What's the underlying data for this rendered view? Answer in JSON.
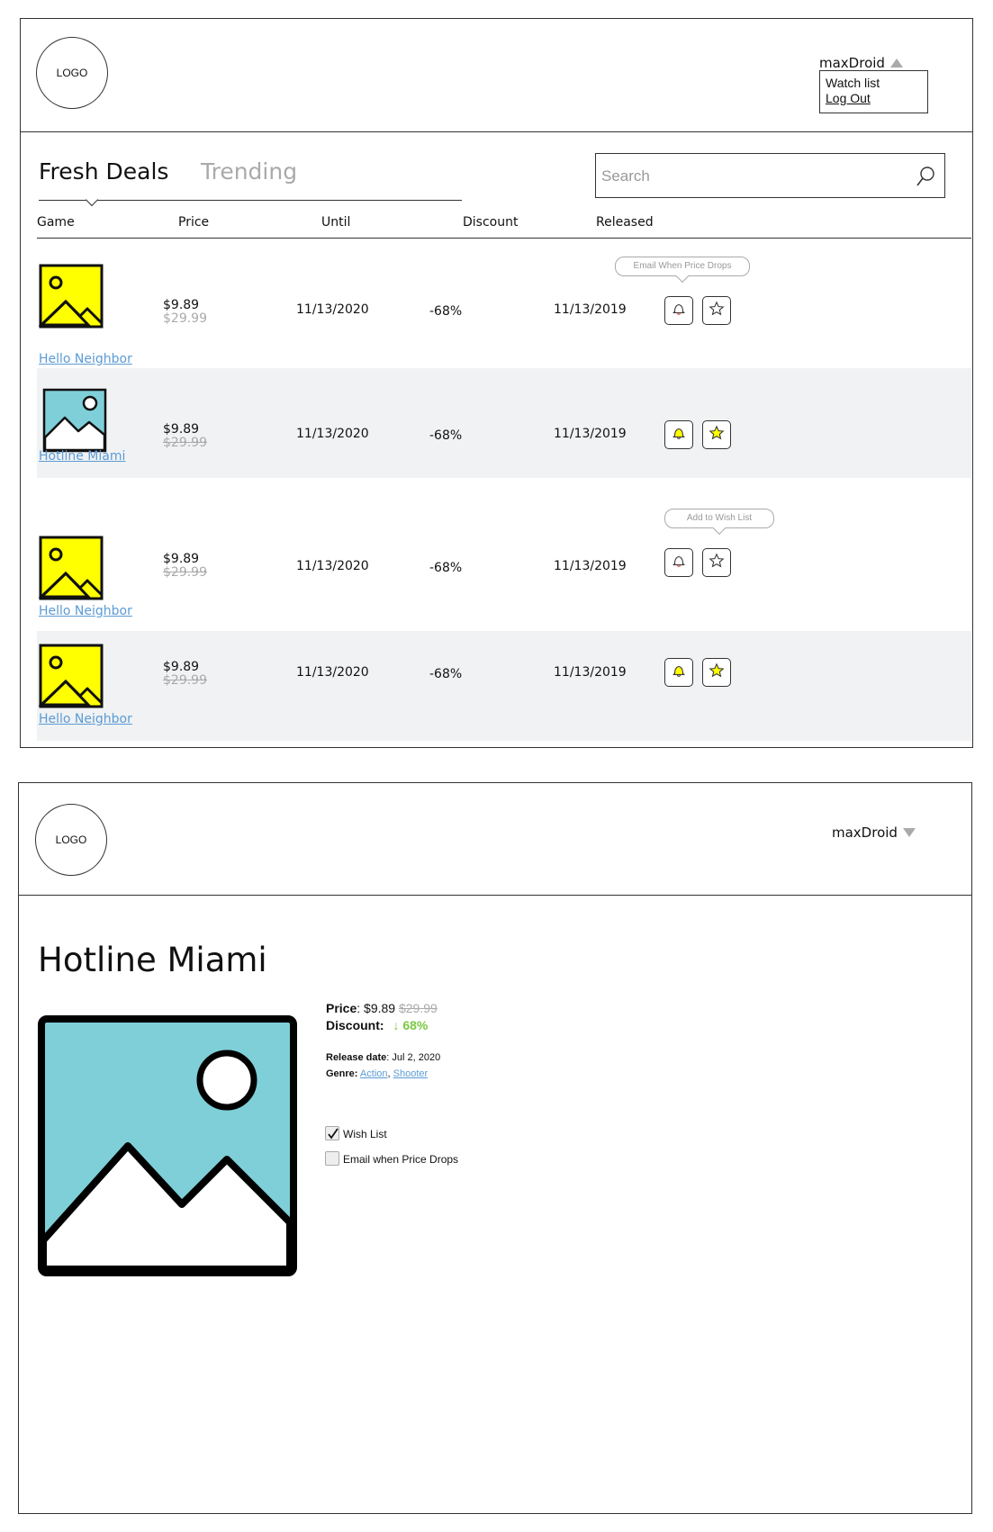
{
  "screen1": {
    "logo": "LOGO",
    "user": {
      "name": "maxDroid",
      "menu": [
        "Watch list",
        "Log Out"
      ]
    },
    "tabs": {
      "active": "Fresh Deals",
      "inactive": "Trending"
    },
    "search": {
      "placeholder": "Search"
    },
    "columns": [
      "Game",
      "Price",
      "Until",
      "Discount",
      "Released"
    ],
    "rows": [
      {
        "name": "Hello Neighbor",
        "thumb": "yellow",
        "price": "$9.89",
        "old_price": "$29.99",
        "until": "11/13/2020",
        "discount": "-68%",
        "released": "11/13/2019",
        "bell_on": false,
        "star_on": false,
        "tooltip": "Email When Price Drops"
      },
      {
        "name": "Hotline Miami",
        "thumb": "blue",
        "price": "$9.89",
        "old_price": "$29.99",
        "until": "11/13/2020",
        "discount": "-68%",
        "released": "11/13/2019",
        "bell_on": true,
        "star_on": true,
        "tooltip": ""
      },
      {
        "name": "Hello Neighbor",
        "thumb": "yellow",
        "price": "$9.89",
        "old_price": "$29.99",
        "until": "11/13/2020",
        "discount": "-68%",
        "released": "11/13/2019",
        "bell_on": false,
        "star_on": false,
        "tooltip": "Add to Wish List"
      },
      {
        "name": "Hello Neighbor",
        "thumb": "yellow",
        "price": "$9.89",
        "old_price": "$29.99",
        "until": "11/13/2020",
        "discount": "-68%",
        "released": "11/13/2019",
        "bell_on": true,
        "star_on": true,
        "tooltip": ""
      }
    ]
  },
  "screen2": {
    "logo": "LOGO",
    "user": {
      "name": "maxDroid"
    },
    "title": "Hotline Miami",
    "price_label": "Price",
    "price": "$9.89",
    "old_price": "$29.99",
    "discount_label": "Discount:",
    "discount": "68%",
    "release_label": "Release date",
    "release_date": "Jul 2, 2020",
    "genre_label": "Genre:",
    "genres": [
      "Action",
      "Shooter"
    ],
    "wishlist_label": "Wish List",
    "wishlist_checked": true,
    "email_label": "Email when Price Drops",
    "email_checked": false
  },
  "colors": {
    "accent_yellow": "#ffff00",
    "image_blue": "#7ecfd8",
    "link_blue": "#5b9bd5",
    "discount_green": "#7ac943",
    "row_shade": "#f0f2f4"
  }
}
